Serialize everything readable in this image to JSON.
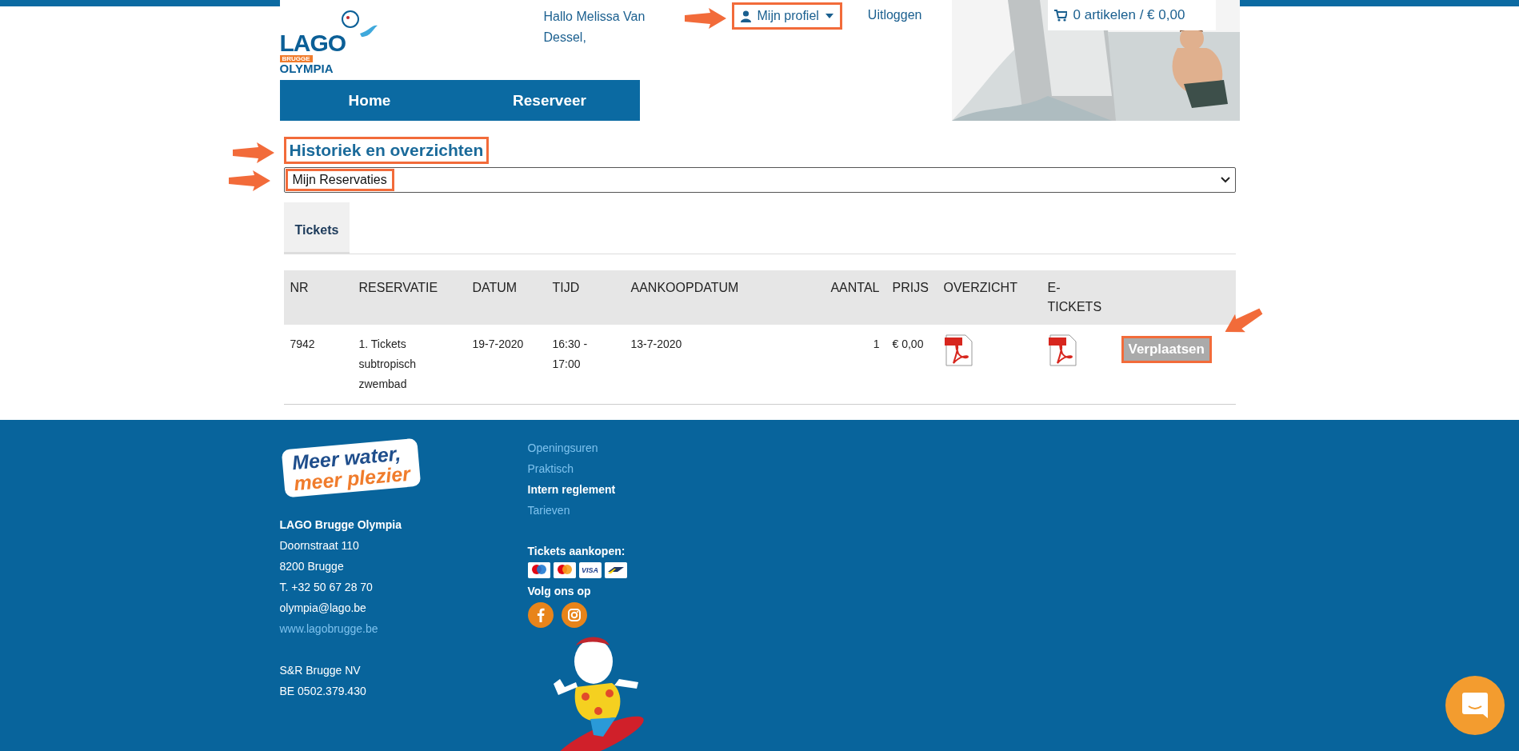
{
  "header": {
    "logo": {
      "line_1": "LAGO",
      "line_2": "BRUGGE",
      "line_3": "OLYMPIA"
    },
    "greeting": "Hallo Melissa Van Dessel,",
    "profile_menu": {
      "label": "Mijn profiel",
      "highlighted": true
    },
    "logout": "Uitloggen",
    "cart": "0 artikelen / € 0,00"
  },
  "nav": [
    {
      "label": "Home"
    },
    {
      "label": "Reserveer"
    }
  ],
  "page_title": {
    "text": "Historiek en overzichten",
    "highlighted": true
  },
  "view_select": {
    "value": "Mijn Reservaties",
    "highlighted": true
  },
  "tabs": [
    {
      "label": "Tickets",
      "selected": true
    }
  ],
  "table": {
    "columns": [
      "NR",
      "RESERVATIE",
      "DATUM",
      "TIJD",
      "AANKOOPDATUM",
      "AANTAL",
      "PRIJS",
      "OVERZICHT",
      "E-TICKETS"
    ],
    "rows": [
      {
        "cells": [
          "7942",
          "1. Tickets subtropisch zwembad",
          "19-7-2020",
          "16:30 - 17:00",
          "13-7-2020",
          "1",
          "€ 0,00"
        ],
        "action": {
          "label": "Verplaatsen",
          "highlighted": true
        }
      }
    ]
  },
  "footer": {
    "slogan": {
      "line_1": "Meer water,",
      "line_2": "meer plezier"
    },
    "address": [
      {
        "text": "LAGO Brugge Olympia",
        "kind": "bold"
      },
      {
        "text": "Doornstraat 110",
        "kind": "plain"
      },
      {
        "text": "8200 Brugge",
        "kind": "plain"
      },
      {
        "text": "T. +32 50 67 28 70",
        "kind": "plain"
      },
      {
        "text": "olympia@lago.be",
        "kind": "plain"
      },
      {
        "text": "www.lagobrugge.be",
        "kind": "link"
      }
    ],
    "company": [
      "S&R Brugge NV",
      "BE 0502.379.430"
    ],
    "links": [
      {
        "label": "Openingsuren",
        "current": false
      },
      {
        "label": "Praktisch",
        "current": false
      },
      {
        "label": "Intern reglement",
        "current": true
      },
      {
        "label": "Tarieven",
        "current": false
      }
    ],
    "tickets_heading": "Tickets aankopen:",
    "payments": [
      {
        "kind": "maestro"
      },
      {
        "kind": "mastercard"
      },
      {
        "kind": "visa",
        "label": "VISA"
      },
      {
        "kind": "bancontact"
      }
    ],
    "social_heading": "Volg ons op",
    "social": [
      {
        "kind": "facebook"
      },
      {
        "kind": "instagram"
      }
    ]
  }
}
